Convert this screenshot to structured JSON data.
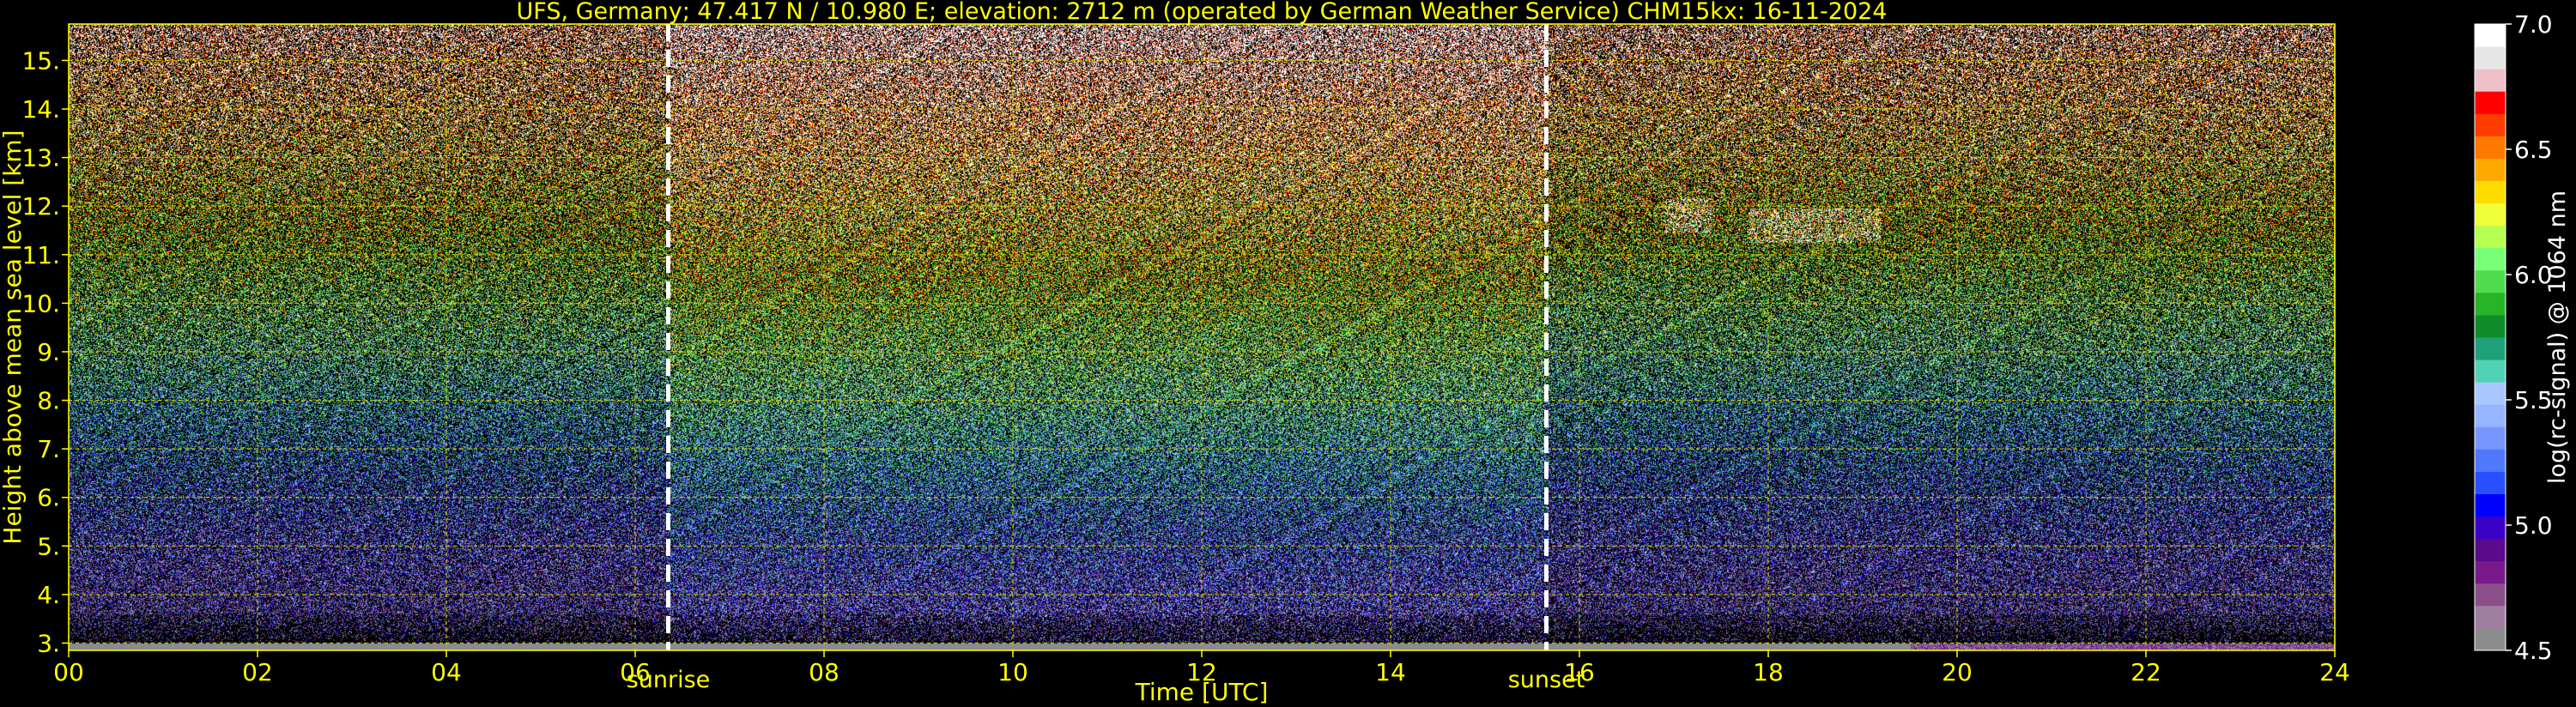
{
  "chart_data": {
    "type": "heatmap",
    "title": "UFS, Germany; 47.417 N / 10.980 E; elevation: 2712 m  (operated by German Weather Service)    CHM15kx: 16-11-2024",
    "xlabel": "Time [UTC]",
    "ylabel": "Height above mean sea level [km]",
    "xlim": [
      0,
      24
    ],
    "ylim": [
      2.85,
      15.75
    ],
    "x_ticks": [
      "00",
      "02",
      "04",
      "06",
      "08",
      "10",
      "12",
      "14",
      "16",
      "18",
      "20",
      "22",
      "24"
    ],
    "y_ticks": [
      "3.",
      "4.",
      "5.",
      "6.",
      "7.",
      "8.",
      "9.",
      "10.",
      "11.",
      "12.",
      "13.",
      "14.",
      "15."
    ],
    "grid": true,
    "markers": [
      {
        "label": "sunrise",
        "x": 6.35
      },
      {
        "label": "sunset",
        "x": 15.65
      }
    ],
    "colorbar": {
      "label": "log(rc-signal) @ 1064 nm",
      "range": [
        4.5,
        7.0
      ],
      "ticks": [
        "4.5",
        "5.0",
        "5.5",
        "6.0",
        "6.5",
        "7.0"
      ],
      "colors": [
        "#8c8c8c",
        "#a07fa0",
        "#8a4f8a",
        "#7a1a8a",
        "#5a0a8a",
        "#3a00c8",
        "#0000ff",
        "#2850ff",
        "#5078ff",
        "#7896ff",
        "#96b4ff",
        "#aac8ff",
        "#50d2b4",
        "#20a078",
        "#108c28",
        "#28b428",
        "#50dc50",
        "#78ff78",
        "#b4ff50",
        "#f0ff3c",
        "#ffdc00",
        "#ffaa00",
        "#ff7800",
        "#ff3c00",
        "#ff0000",
        "#f0c0c8",
        "#e6e6e6",
        "#ffffff"
      ]
    },
    "cloud_features": [
      {
        "x_start": 16.9,
        "x_end": 17.4,
        "height": 11.8
      },
      {
        "x_start": 17.8,
        "x_end": 19.2,
        "height": 11.6
      }
    ],
    "theme": {
      "background": "#000000",
      "text": "#ffff00",
      "grid": "#c8c800"
    }
  }
}
